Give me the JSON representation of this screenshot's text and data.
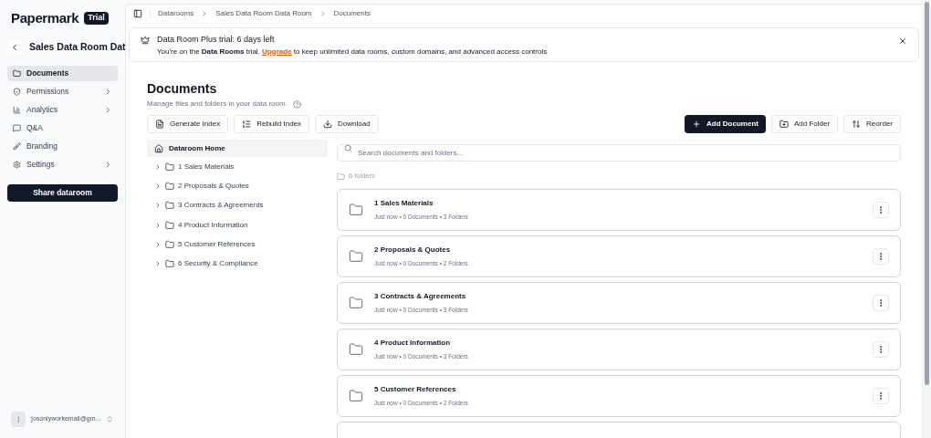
{
  "sidebar": {
    "logo": "Papermark",
    "badge": "Trial",
    "room_title": "Sales Data Room Dat",
    "items": [
      {
        "label": "Documents",
        "selected": true,
        "expandable": false
      },
      {
        "label": "Permissions",
        "selected": false,
        "expandable": true
      },
      {
        "label": "Analytics",
        "selected": false,
        "expandable": true
      },
      {
        "label": "Q&A",
        "selected": false,
        "expandable": false
      },
      {
        "label": "Branding",
        "selected": false,
        "expandable": false
      },
      {
        "label": "Settings",
        "selected": false,
        "expandable": true
      }
    ],
    "share_button": "Share dataroom",
    "user": {
      "initial": "j",
      "email": "josonlyworkemail@gm..."
    }
  },
  "breadcrumb": [
    "Datarooms",
    "Sales Data Room Data Room",
    "Documents"
  ],
  "banner": {
    "title": "Data Room Plus trial: 6 days left",
    "before": "You're on the **Data Rooms** trial. ",
    "link": "Upgrade",
    "after": " to keep unlimited data rooms, custom domains, and advanced access controls"
  },
  "page": {
    "title": "Documents",
    "subtitle": "Manage files and folders in your data room."
  },
  "toolbar_left": [
    {
      "label": "Generate Index"
    },
    {
      "label": "Rebuild Index"
    },
    {
      "label": "Download"
    }
  ],
  "toolbar_right": [
    {
      "label": "Add Document",
      "primary": true
    },
    {
      "label": "Add Folder",
      "primary": false
    },
    {
      "label": "Reorder",
      "primary": false
    }
  ],
  "tree": {
    "root": {
      "label": "Dataroom Home",
      "selected": true
    },
    "items": [
      {
        "label": "1 Sales Materials",
        "expanded": false
      },
      {
        "label": "2 Proposals & Quotes",
        "expanded": false
      },
      {
        "label": "3 Contracts & Agreements",
        "expanded": false
      },
      {
        "label": "4 Product Information",
        "expanded": false
      },
      {
        "label": "5 Customer References",
        "expanded": false
      },
      {
        "label": "6 Security & Compliance",
        "expanded": false
      }
    ]
  },
  "search": {
    "placeholder": "Search documents and folders..."
  },
  "folder_count": "6 folders",
  "folders": [
    {
      "name": "1 Sales Materials",
      "meta": "Just now • 0 Documents • 3 Folders"
    },
    {
      "name": "2 Proposals & Quotes",
      "meta": "Just now • 0 Documents • 2 Folders"
    },
    {
      "name": "3 Contracts & Agreements",
      "meta": "Just now • 0 Documents • 3 Folders"
    },
    {
      "name": "4 Product Information",
      "meta": "Just now • 0 Documents • 3 Folders"
    },
    {
      "name": "5 Customer References",
      "meta": "Just now • 0 Documents • 2 Folders"
    }
  ]
}
